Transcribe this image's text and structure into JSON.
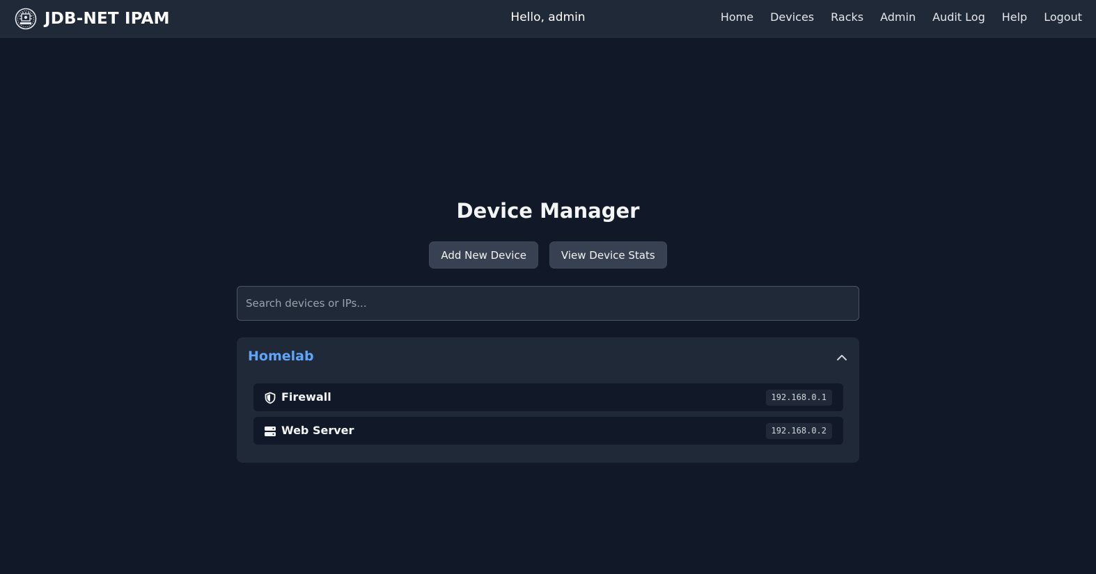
{
  "navbar": {
    "brand": "JDB-NET IPAM",
    "greeting": "Hello, admin",
    "links": [
      "Home",
      "Devices",
      "Racks",
      "Admin",
      "Audit Log",
      "Help",
      "Logout"
    ]
  },
  "main": {
    "title": "Device Manager",
    "add_button": "Add New Device",
    "stats_button": "View Device Stats",
    "search_placeholder": "Search devices or IPs..."
  },
  "groups": [
    {
      "name": "Homelab",
      "expanded": true,
      "devices": [
        {
          "name": "Firewall",
          "ip": "192.168.0.1",
          "icon": "shield-icon"
        },
        {
          "name": "Web Server",
          "ip": "192.168.0.2",
          "icon": "server-icon"
        }
      ]
    }
  ],
  "colors": {
    "background": "#111827",
    "surface": "#1f2937",
    "button": "#374151",
    "accent": "#60a5fa"
  }
}
